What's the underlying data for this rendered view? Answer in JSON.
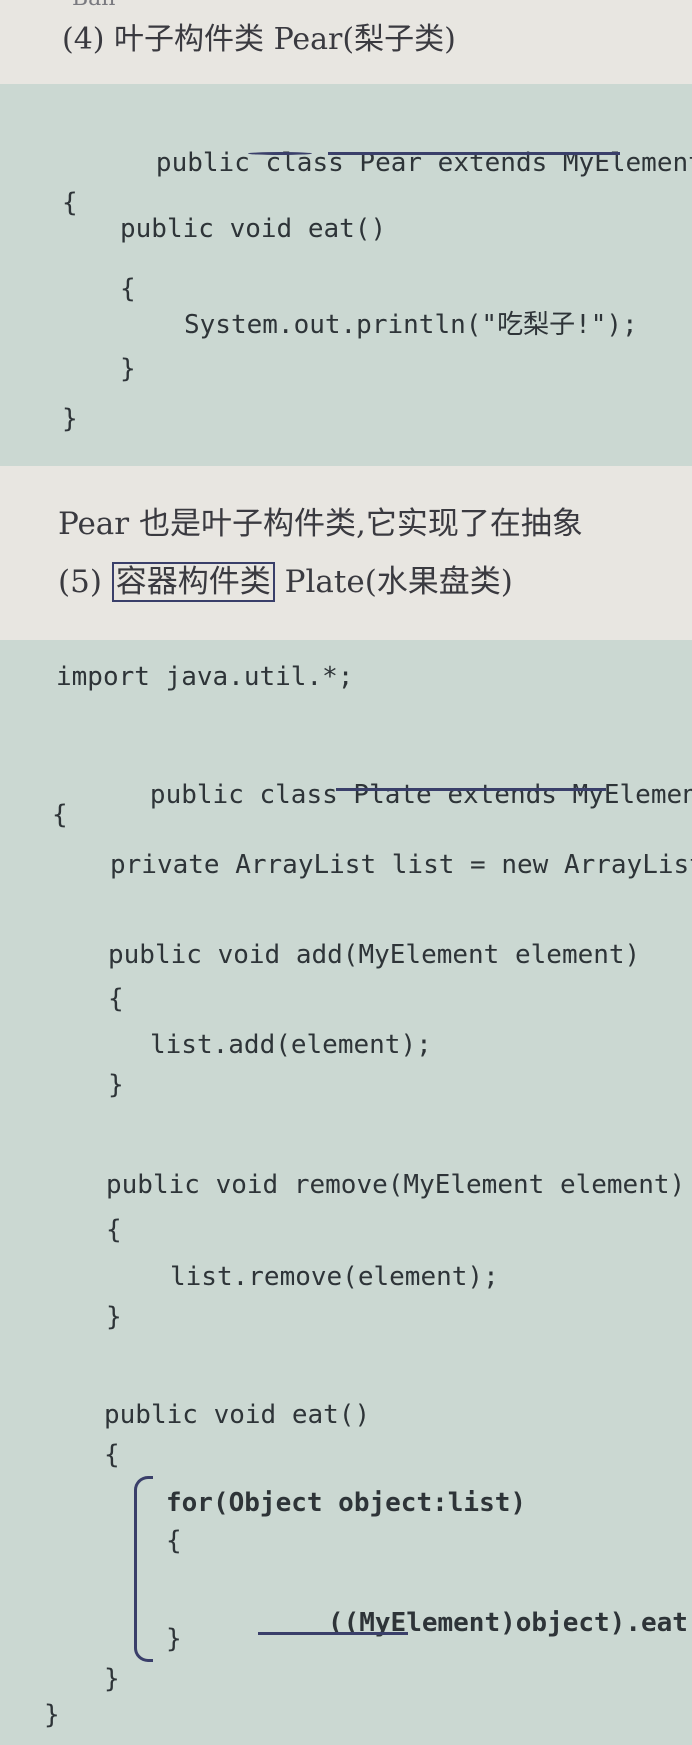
{
  "page": {
    "cut_top": "Ban",
    "heading_pear": "(4) 叶子构件类 Pear(梨子类)",
    "pear_code": [
      "public class Pear extends MyElement",
      "{",
      "public void eat()",
      "{",
      "System.out.println(\"吃梨子!\");",
      "}",
      "}"
    ],
    "pear_desc": "Pear 也是叶子构件类,它实现了在抽象",
    "heading_plate_num": "(5)",
    "heading_plate_boxed": "容器构件类",
    "heading_plate_rest": "Plate(水果盘类)",
    "plate_code": [
      "import java.util.*;",
      "public class Plate extends MyElement",
      "{",
      "private ArrayList list = new ArrayList",
      "public void add(MyElement element)",
      "{",
      "list.add(element);",
      "}",
      "public void remove(MyElement element)",
      "{",
      "list.remove(element);",
      "}",
      "public void eat()",
      "{",
      "for(Object object:list)",
      "{",
      "((MyElement)object).eat();",
      "}",
      "}",
      "}"
    ]
  }
}
